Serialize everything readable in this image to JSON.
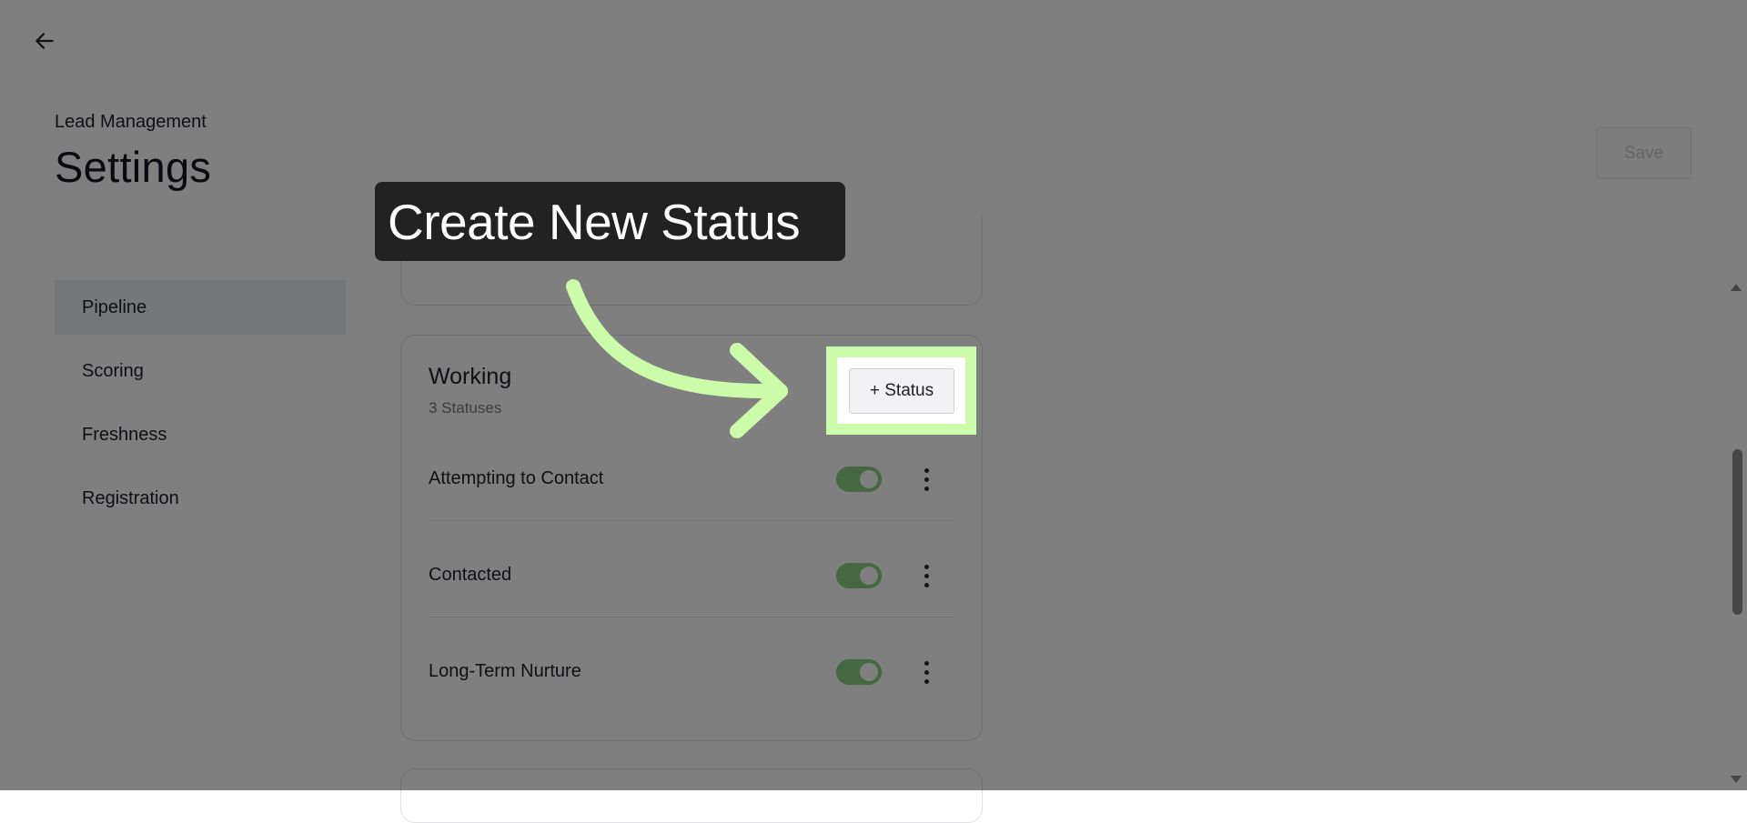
{
  "header": {
    "back_icon": "arrow-left-icon",
    "subtitle": "Lead Management",
    "title": "Settings",
    "save_label": "Save"
  },
  "sidebar": {
    "items": [
      {
        "label": "Pipeline",
        "active": true
      },
      {
        "label": "Scoring",
        "active": false
      },
      {
        "label": "Freshness",
        "active": false
      },
      {
        "label": "Registration",
        "active": false
      }
    ]
  },
  "group": {
    "title": "Working",
    "count": "3 Statuses",
    "add_button": "+ Status",
    "statuses": [
      {
        "label": "Attempting to Contact",
        "enabled": true
      },
      {
        "label": "Contacted",
        "enabled": true
      },
      {
        "label": "Long-Term Nurture",
        "enabled": true
      }
    ]
  },
  "tutorial": {
    "callout_text": "Create New Status",
    "highlight_color": "#ccfcaa"
  },
  "colors": {
    "toggle_on": "#8bcf82",
    "overlay": "rgba(0,0,0,0.5)"
  }
}
